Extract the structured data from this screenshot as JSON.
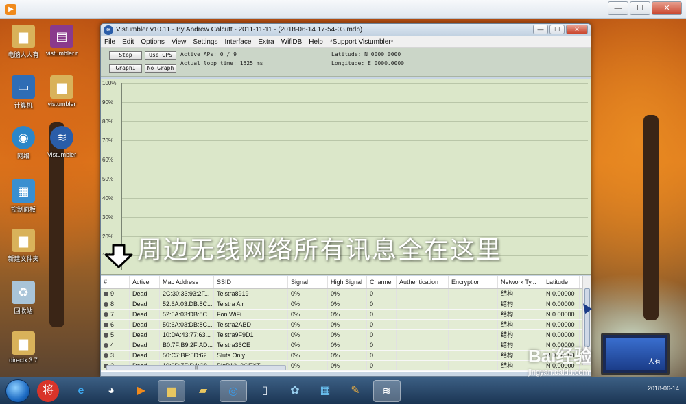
{
  "outer": {
    "app_icon": "play-icon"
  },
  "desktop": {
    "icons": [
      {
        "label": "电脑人人有",
        "glyph": "folder"
      },
      {
        "label": "vistumbler.r",
        "glyph": "archive"
      },
      {
        "label": "计算机",
        "glyph": "computer"
      },
      {
        "label": "vistumbler",
        "glyph": "folder"
      },
      {
        "label": "网络",
        "glyph": "network"
      },
      {
        "label": "Vistumbler",
        "glyph": "app"
      },
      {
        "label": "控制面板",
        "glyph": "control-panel"
      },
      {
        "label": "新建文件夹",
        "glyph": "folder"
      },
      {
        "label": "回收站",
        "glyph": "recycle-bin"
      },
      {
        "label": "directx 3.7",
        "glyph": "folder"
      }
    ]
  },
  "window": {
    "title": "Vistumbler v10.11 - By Andrew Calcutt - 2011-11-11 - (2018-06-14 17-54-03.mdb)"
  },
  "menu": [
    "File",
    "Edit",
    "Options",
    "View",
    "Settings",
    "Interface",
    "Extra",
    "WifiDB",
    "Help",
    "*Support Vistumbler*"
  ],
  "toolbar": {
    "stop": "Stop",
    "use_gps": "Use GPS",
    "graph": "Graph1",
    "no_graph": "No Graph",
    "active_aps": "Active APs: 0 / 9",
    "loop_time": "Actual loop time: 1525 ms",
    "latitude": "Latitude: N 0000.0000",
    "longitude": "Longitude: E 0000.0000"
  },
  "graph": {
    "y_labels": [
      "100%",
      "90%",
      "80%",
      "70%",
      "60%",
      "50%",
      "40%",
      "30%",
      "20%",
      "10%"
    ]
  },
  "overlay": {
    "caption": "周边无线网络所有讯息全在这里"
  },
  "table": {
    "headers": [
      "#",
      "Active",
      "Mac Address",
      "SSID",
      "Signal",
      "High Signal",
      "Channel",
      "Authentication",
      "Encryption",
      "Network Ty...",
      "Latitude"
    ],
    "rows": [
      [
        "9",
        "Dead",
        "2C:30:33:93:2F...",
        "Telstra8919",
        "0%",
        "0%",
        "0",
        "",
        "",
        "结构",
        "N 0.00000"
      ],
      [
        "8",
        "Dead",
        "52:6A:03:DB:8C...",
        "Telstra Air",
        "0%",
        "0%",
        "0",
        "",
        "",
        "结构",
        "N 0.00000"
      ],
      [
        "7",
        "Dead",
        "52:6A:03:DB:8C...",
        "Fon WiFi",
        "0%",
        "0%",
        "0",
        "",
        "",
        "结构",
        "N 0.00000"
      ],
      [
        "6",
        "Dead",
        "50:6A:03:DB:8C...",
        "Telstra2ABD",
        "0%",
        "0%",
        "0",
        "",
        "",
        "结构",
        "N 0.00000"
      ],
      [
        "5",
        "Dead",
        "10:DA:43:77:63...",
        "Telstra9F9D1",
        "0%",
        "0%",
        "0",
        "",
        "",
        "结构",
        "N 0.00000"
      ],
      [
        "4",
        "Dead",
        "B0:7F:B9:2F:AD...",
        "Telstra36CE",
        "0%",
        "0%",
        "0",
        "",
        "",
        "结构",
        "N 0.00000"
      ],
      [
        "3",
        "Dead",
        "50:C7:BF:5D:62...",
        "Sluts Only",
        "0%",
        "0%",
        "0",
        "",
        "",
        "结构",
        "N 0.00000"
      ],
      [
        "2",
        "Dead",
        "10:0D:7F:D4:C8...",
        "BigP13_2GEXT",
        "0%",
        "0%",
        "0",
        "",
        "",
        "结构",
        "N 0.00000"
      ]
    ],
    "hscroll_glyph": "|||"
  },
  "watermark": {
    "brand": "Bai经验",
    "url": "jingyan.baidu.com",
    "laptop_text": "人有"
  },
  "taskbar": {
    "items": [
      "start",
      "browser-360",
      "internet-explorer",
      "chrome",
      "media-player",
      "file-explorer",
      "folder",
      "vistumbler-orb",
      "document",
      "network-tool",
      "control-panel",
      "paint",
      "vistumbler"
    ],
    "clock": "2018-06-14"
  }
}
